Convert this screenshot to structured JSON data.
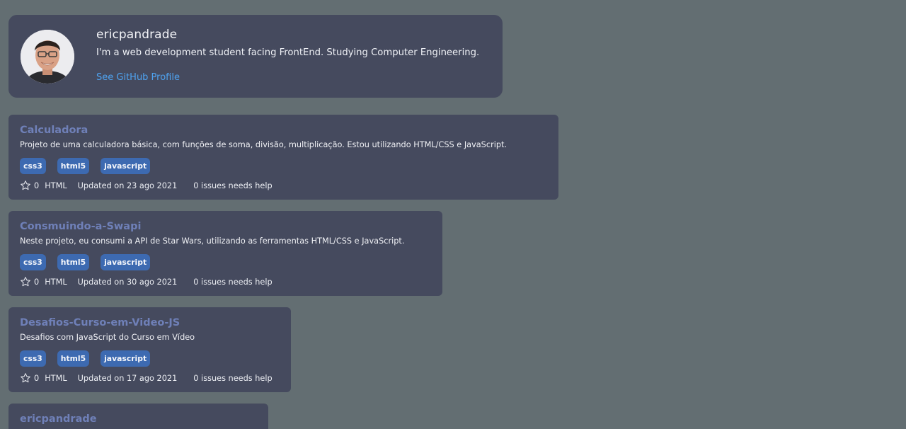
{
  "profile": {
    "username": "ericpandrade",
    "bio": "I'm a web development student facing FrontEnd. Studying Computer Engineering.",
    "link_label": "See GitHub Profile"
  },
  "repos": [
    {
      "title": "Calculadora",
      "description": "Projeto de uma calculadora básica, com funções de soma, divisão, multiplicação. Estou utilizando HTML/CSS e JavaScript.",
      "tags": [
        "css3",
        "html5",
        "javascript"
      ],
      "stars": "0",
      "language": "HTML",
      "updated": "Updated on 23 ago 2021",
      "issues": "0 issues needs help"
    },
    {
      "title": "Consmuindo-a-Swapi",
      "description": "Neste projeto, eu consumi a API de Star Wars, utilizando as ferramentas HTML/CSS e JavaScript.",
      "tags": [
        "css3",
        "html5",
        "javascript"
      ],
      "stars": "0",
      "language": "HTML",
      "updated": "Updated on 30 ago 2021",
      "issues": "0 issues needs help"
    },
    {
      "title": "Desafios-Curso-em-Video-JS",
      "description": "Desafios com JavaScript do Curso em Vídeo",
      "tags": [
        "css3",
        "html5",
        "javascript"
      ],
      "stars": "0",
      "language": "HTML",
      "updated": "Updated on 17 ago 2021",
      "issues": "0 issues needs help"
    },
    {
      "title": "ericpandrade"
    }
  ],
  "colors": {
    "background": "#636e72",
    "card": "#454a5e",
    "repo_title": "#6f80b8",
    "link": "#4fa3f0",
    "tag": "#3d6ab1"
  }
}
